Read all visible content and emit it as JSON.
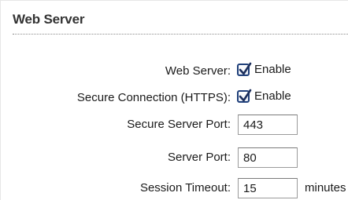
{
  "section": {
    "title": "Web Server"
  },
  "fields": {
    "web_server": {
      "label": "Web Server:",
      "checked": true,
      "option_label": "Enable"
    },
    "secure_connection": {
      "label": "Secure Connection (HTTPS):",
      "checked": true,
      "option_label": "Enable"
    },
    "secure_server_port": {
      "label": "Secure Server Port:",
      "value": "443"
    },
    "server_port": {
      "label": "Server Port:",
      "value": "80"
    },
    "session_timeout": {
      "label": "Session Timeout:",
      "value": "15",
      "unit": "minutes"
    }
  },
  "colors": {
    "checkbox_border": "#1f3f7a",
    "checkmark": "#1c2f5c",
    "rule": "#8a8a8a"
  }
}
